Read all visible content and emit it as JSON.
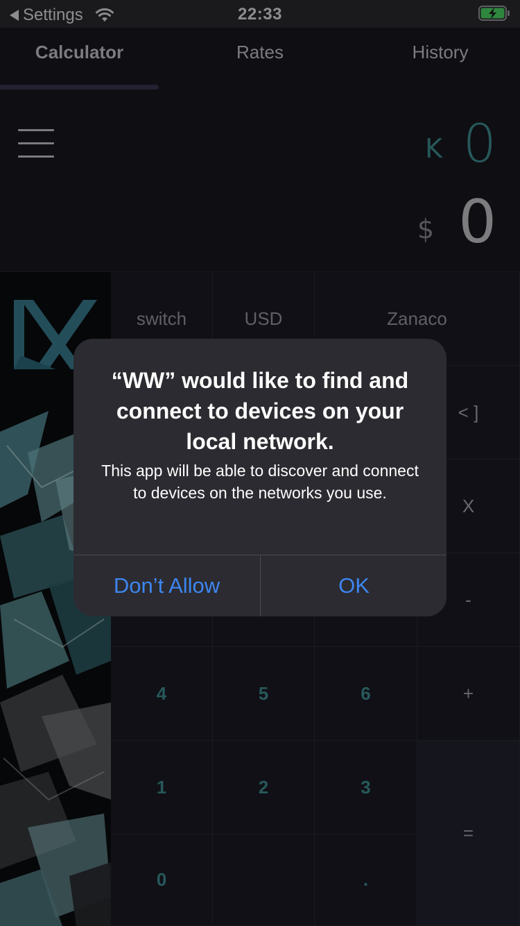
{
  "status_bar": {
    "back_label": "Settings",
    "time": "22:33",
    "icons": [
      "back-triangle-icon",
      "wifi-icon",
      "battery-charging-icon"
    ],
    "battery_color": "#4cd964"
  },
  "tabs": [
    {
      "label": "Calculator",
      "active": true
    },
    {
      "label": "Rates",
      "active": false
    },
    {
      "label": "History",
      "active": false
    }
  ],
  "display": {
    "primary": {
      "symbol": "K",
      "value": "0"
    },
    "secondary": {
      "symbol": "$",
      "value": "0"
    }
  },
  "keypad": {
    "switch": "switch",
    "currency": "USD",
    "provider": "Zanaco",
    "backspace": "< ]",
    "multiply": "X",
    "minus": "-",
    "plus": "+",
    "equals": "=",
    "n4": "4",
    "n5": "5",
    "n6": "6",
    "n1": "1",
    "n2": "2",
    "n3": "3",
    "n0": "0",
    "dot": "."
  },
  "dialog": {
    "title": "“WW” would like to find and connect to devices on your local network.",
    "message": "This app will be able to discover and connect to devices on the networks you use.",
    "deny_label": "Don’t Allow",
    "ok_label": "OK"
  },
  "colors": {
    "accent_teal": "#3f8f92",
    "dialog_button_blue": "#3d86f0",
    "background": "#17171f"
  }
}
